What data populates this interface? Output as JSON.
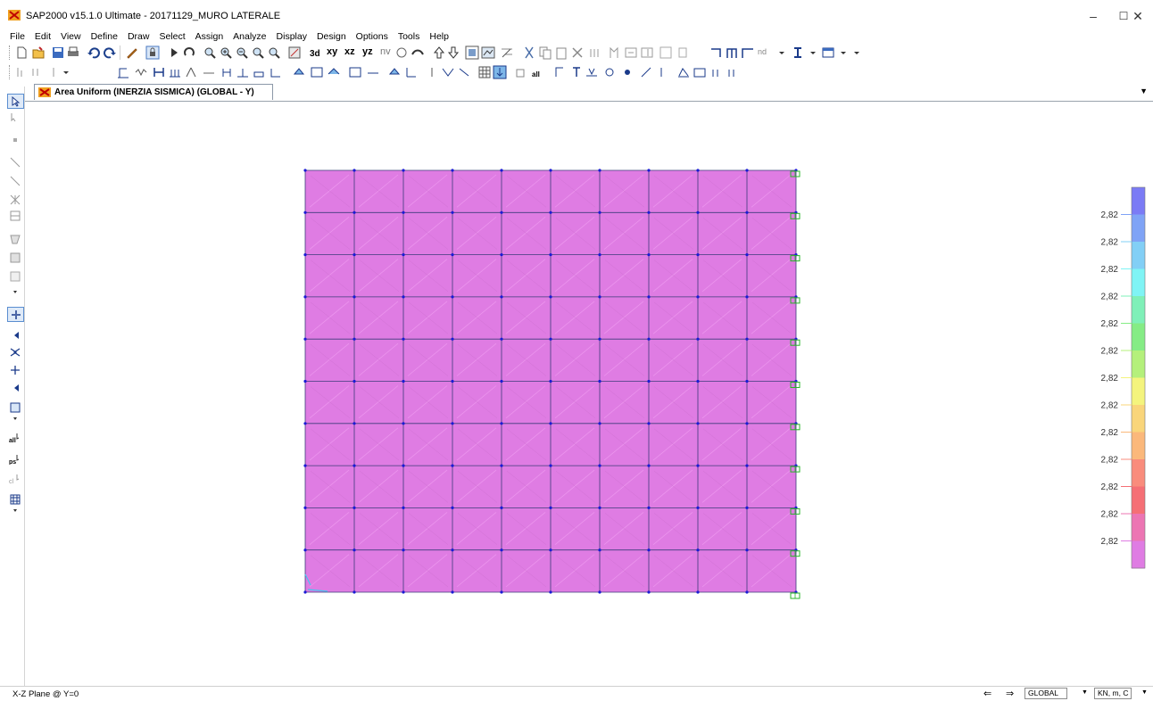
{
  "window": {
    "title": "SAP2000 v15.1.0 Ultimate - 20171129_MURO LATERALE",
    "minimize_glyph": "–",
    "maximize_glyph": "☐",
    "close_glyph": "✕"
  },
  "menu": [
    "File",
    "Edit",
    "View",
    "Define",
    "Draw",
    "Select",
    "Assign",
    "Analyze",
    "Display",
    "Design",
    "Options",
    "Tools",
    "Help"
  ],
  "toolbar1": {
    "view_labels": [
      "xy",
      "xz",
      "yz",
      "nv"
    ],
    "nd_label": "nd"
  },
  "tab": {
    "label": "Area Uniform (INERZIA SISMICA) (GLOBAL - Y)",
    "dropdown_glyph": "▼"
  },
  "model": {
    "columns": 10,
    "rows": 10,
    "area_color": "#df7ce3",
    "frame_color": "#3d3d7a",
    "joint_color": "#1a1ad6",
    "restraint_color": "#27b427"
  },
  "legend": {
    "labels": [
      "2,82",
      "2,82",
      "2,82",
      "2,82",
      "2,82",
      "2,82",
      "2,82",
      "2,82",
      "2,82",
      "2,82",
      "2,82",
      "2,82",
      "2,82",
      "2,82"
    ],
    "colors": [
      "#7b7bf5",
      "#7fa3f6",
      "#82cff6",
      "#7ff4f5",
      "#7ff0b8",
      "#85ec85",
      "#b4f07b",
      "#f4f47d",
      "#f9d57a",
      "#fbb87b",
      "#f98c7c",
      "#f56f75",
      "#ec75b3",
      "#df7ce3"
    ]
  },
  "status": {
    "plane": "X-Z Plane @ Y=0",
    "coord_system": "GLOBAL",
    "units": "KN, m, C",
    "dropdown_glyph": "▼",
    "arrow_left": "⇐",
    "arrow_right": "⇒"
  }
}
